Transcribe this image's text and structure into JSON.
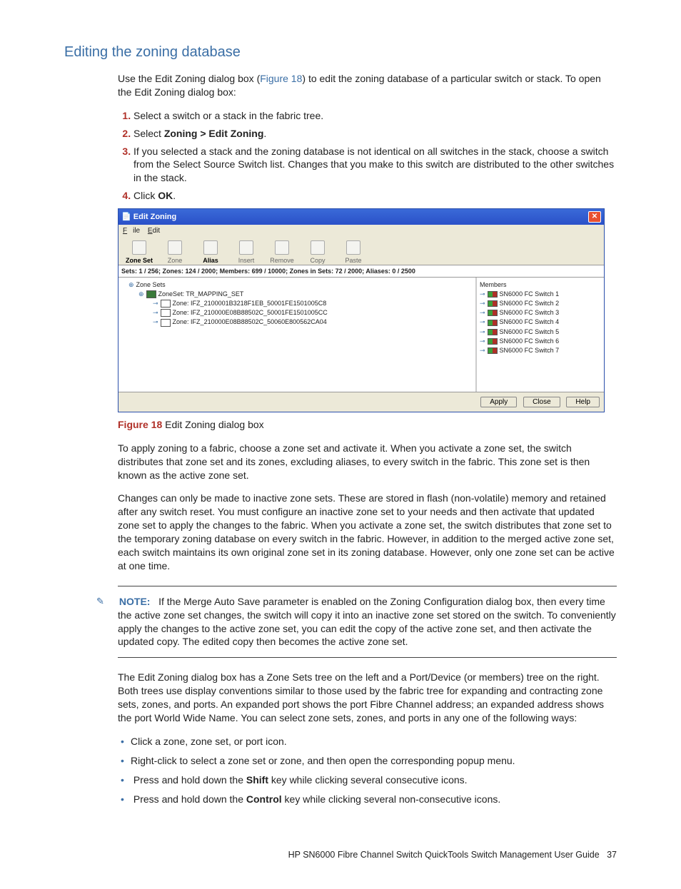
{
  "heading": "Editing the zoning database",
  "intro_a": "Use the Edit Zoning dialog box (",
  "intro_link": "Figure 18",
  "intro_b": ") to edit the zoning database of a particular switch or stack. To open the Edit Zoning dialog box:",
  "steps": {
    "s1": "Select a switch or a stack in the fabric tree.",
    "s2a": "Select ",
    "s2b": "Zoning > Edit Zoning",
    "s2c": ".",
    "s3": "If you selected a stack and the zoning database is not identical on all switches in the stack, choose a switch from the Select Source Switch list. Changes that you make to this switch are distributed to the other switches in the stack.",
    "s4a": "Click ",
    "s4b": "OK",
    "s4c": "."
  },
  "dialog": {
    "title": "Edit Zoning",
    "menu": {
      "file": "File",
      "edit": "Edit"
    },
    "tools": {
      "zoneset": "Zone Set",
      "zone": "Zone",
      "alias": "Alias",
      "insert": "Insert",
      "remove": "Remove",
      "copy": "Copy",
      "paste": "Paste"
    },
    "status": "Sets: 1 / 256;  Zones: 124 / 2000;  Members: 699 / 10000;  Zones in Sets: 72 / 2000;  Aliases: 0 / 2500",
    "tree": {
      "root": "Zone Sets",
      "set": "ZoneSet: TR_MAPPING_SET",
      "z1": "Zone: IFZ_2100001B3218F1EB_50001FE1501005C8",
      "z2": "Zone: IFZ_210000E08B88502C_50001FE1501005CC",
      "z3": "Zone: IFZ_210000E08B88502C_50060E800562CA04"
    },
    "members": {
      "title": "Members",
      "m1": "SN6000 FC Switch 1",
      "m2": "SN6000 FC Switch 2",
      "m3": "SN6000 FC Switch 3",
      "m4": "SN6000 FC Switch 4",
      "m5": "SN6000 FC Switch 5",
      "m6": "SN6000 FC Switch 6",
      "m7": "SN6000 FC Switch 7"
    },
    "buttons": {
      "apply": "Apply",
      "close": "Close",
      "help": "Help"
    }
  },
  "figcap_num": "Figure 18",
  "figcap_text": " Edit Zoning dialog box",
  "p_apply": "To apply zoning to a fabric, choose a zone set and activate it. When you activate a zone set, the switch distributes that zone set and its zones, excluding aliases, to every switch in the fabric. This zone set is then known as the active zone set.",
  "p_changes": "Changes can only be made to inactive zone sets. These are stored in flash (non-volatile) memory and retained after any switch reset. You must configure an inactive zone set to your needs and then activate that updated zone set to apply the changes to the fabric. When you activate a zone set, the switch distributes that zone set to the temporary zoning database on every switch in the fabric. However, in addition to the merged active zone set, each switch maintains its own original zone set in its zoning database. However, only one zone set can be active at one time.",
  "note_label": "NOTE:",
  "note_text": "If the Merge Auto Save parameter is enabled on the Zoning Configuration dialog box, then every time the active zone set changes, the switch will copy it into an inactive zone set stored on the switch. To conveniently apply the changes to the active zone set, you can edit the copy of the active zone set, and then activate the updated copy. The edited copy then becomes the active zone set.",
  "p_tree": "The Edit Zoning dialog box has a Zone Sets tree on the left and a Port/Device (or members) tree on the right. Both trees use display conventions similar to those used by the fabric tree for expanding and contracting zone sets, zones, and ports. An expanded port shows the port Fibre Channel address; an expanded address shows the port World Wide Name. You can select zone sets, zones, and ports in any one of the following ways:",
  "bullets": {
    "b1": "Click a zone, zone set, or port icon.",
    "b2": "Right-click to select a zone set or zone, and then open the corresponding popup menu.",
    "b3a": "Press and hold down the ",
    "b3b": "Shift",
    "b3c": " key while clicking several consecutive icons.",
    "b4a": "Press and hold down the ",
    "b4b": "Control",
    "b4c": " key while clicking several non-consecutive icons."
  },
  "footer_text": "HP SN6000 Fibre Channel Switch QuickTools Switch Management User Guide",
  "footer_page": "37"
}
